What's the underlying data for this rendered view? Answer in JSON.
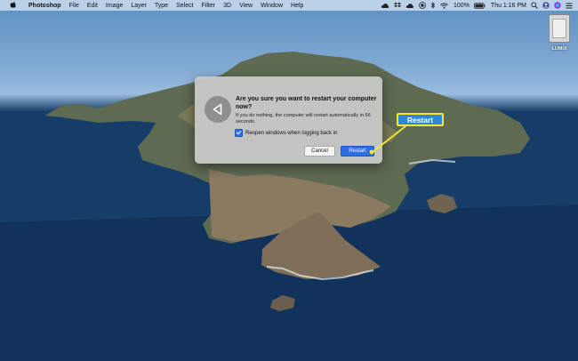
{
  "menubar": {
    "app_name": "Photoshop",
    "menus": [
      "File",
      "Edit",
      "Image",
      "Layer",
      "Type",
      "Select",
      "Filter",
      "3D",
      "View",
      "Window",
      "Help"
    ],
    "battery": "100%",
    "clock": "Thu 1:16 PM"
  },
  "desktop": {
    "drive_label": "LUMIX"
  },
  "dialog": {
    "title": "Are you sure you want to restart your computer now?",
    "message": "If you do nothing, the computer will restart automatically in 56 seconds.",
    "checkbox_label": "Reopen windows when logging back in",
    "checkbox_checked": true,
    "cancel_label": "Cancel",
    "restart_label": "Restart"
  },
  "annotation": {
    "callout_text": "Restart",
    "callout_color": "#2f86e0",
    "outline_color": "#f2ea2d"
  },
  "icons": {
    "apple": "apple-icon",
    "status": [
      "creative-cloud-icon",
      "dropbox-icon",
      "cloud-icon",
      "record-icon",
      "bluetooth-icon",
      "wifi-icon",
      "battery-icon",
      "search-icon",
      "user-icon",
      "siri-icon",
      "list-icon"
    ],
    "dialog": "restart-arrow-icon"
  }
}
